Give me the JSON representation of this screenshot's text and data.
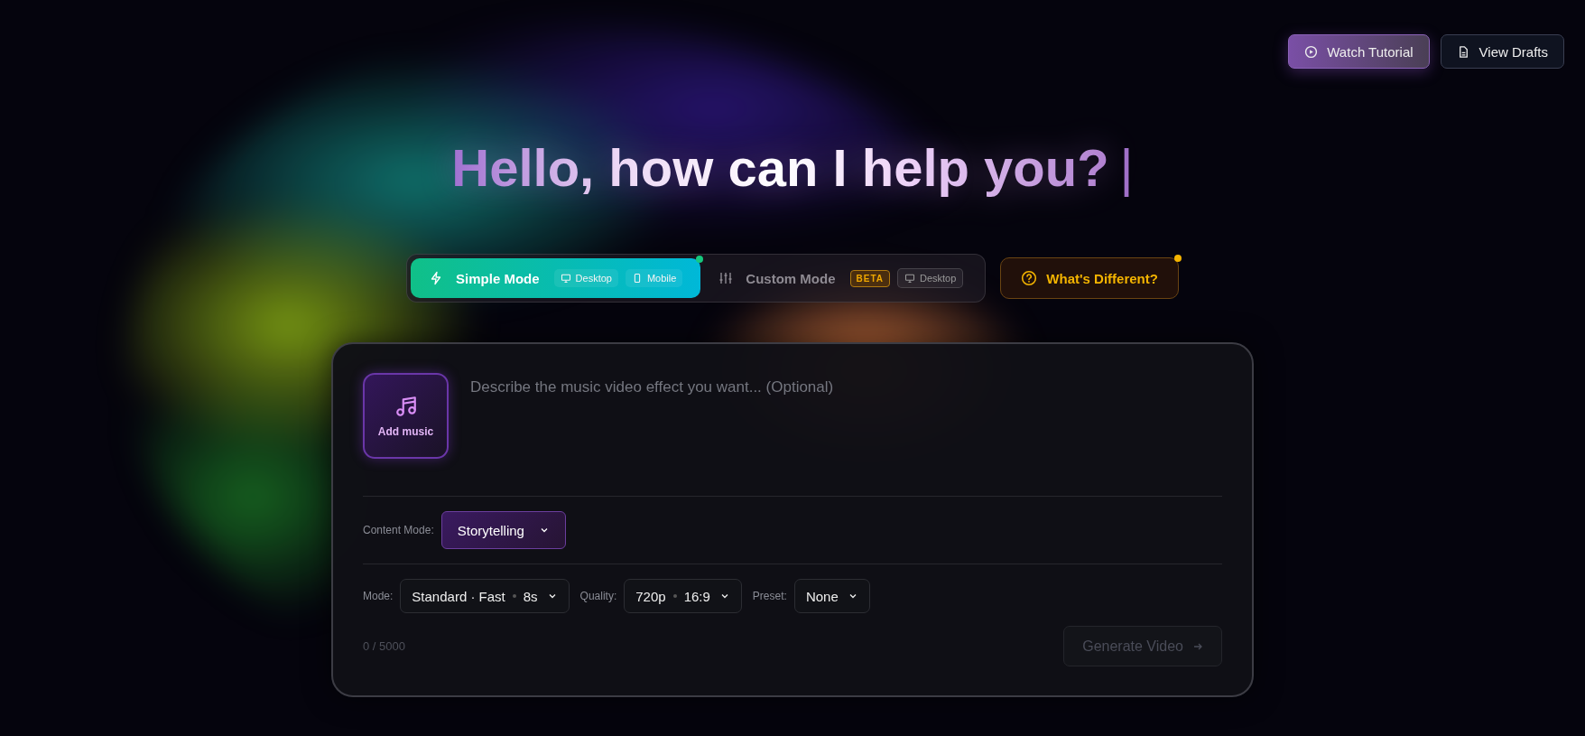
{
  "top_actions": [
    {
      "label": "Watch Tutorial",
      "kind": "primary"
    },
    {
      "label": "View Drafts",
      "kind": "secondary"
    }
  ],
  "headline": {
    "text": "Hello, how can I help you?",
    "cursor": "|"
  },
  "modes": [
    {
      "label": "Simple Mode",
      "selected": true,
      "kind": "simple",
      "tags": [
        {
          "label": "Desktop",
          "kind": "desktop"
        },
        {
          "label": "Mobile",
          "kind": "mobile"
        }
      ]
    },
    {
      "label": "Custom Mode",
      "selected": false,
      "kind": "custom",
      "badge": "BETA",
      "tags": [
        {
          "label": "Desktop",
          "kind": "desktop"
        }
      ]
    }
  ],
  "help_button": {
    "label": "What's Different?"
  },
  "composer": {
    "add_music": "Add music",
    "placeholder": "Describe the music video effect you want... (Optional)",
    "content_mode": {
      "label": "Content Mode:",
      "value": "Storytelling"
    },
    "settings": [
      {
        "label": "Mode:",
        "parts": [
          "Standard · Fast",
          "8s"
        ]
      },
      {
        "label": "Quality:",
        "parts": [
          "720p",
          "16:9"
        ]
      },
      {
        "label": "Preset:",
        "parts": [
          "None"
        ]
      }
    ],
    "counter": "0 / 5000",
    "generate": {
      "label": "Generate Video",
      "disabled": true
    }
  }
}
